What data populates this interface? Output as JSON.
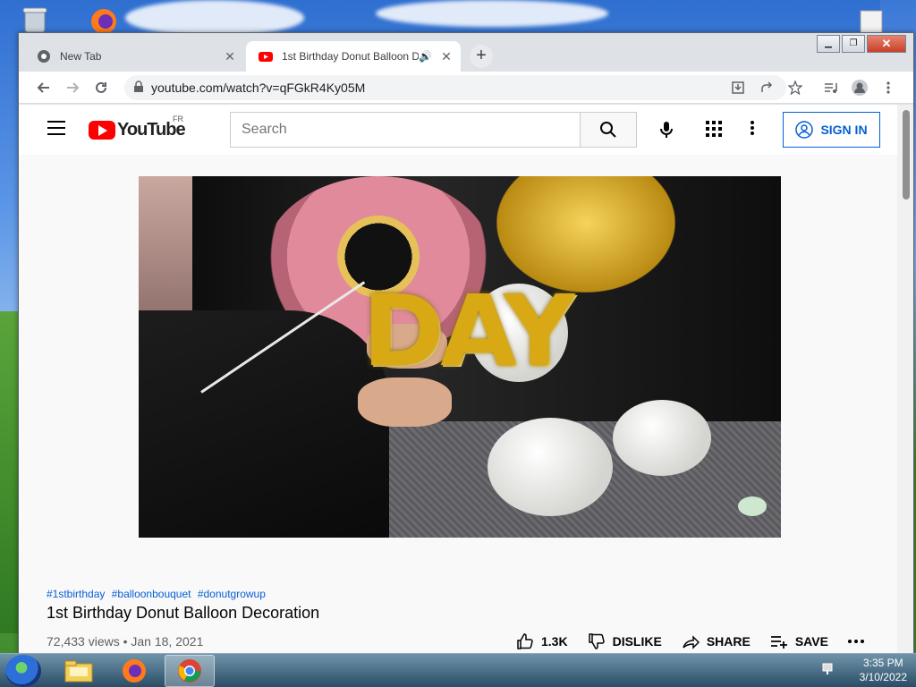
{
  "browser": {
    "tabs": [
      {
        "title": "New Tab"
      },
      {
        "title": "1st Birthday Donut Balloon D"
      }
    ],
    "address": "youtube.com/watch?v=qFGkR4Ky05M"
  },
  "youtube": {
    "region": "FR",
    "logo_text": "YouTube",
    "search_placeholder": "Search",
    "sign_in": "SIGN IN"
  },
  "video": {
    "hashtags": [
      "#1stbirthday",
      "#balloonbouquet",
      "#donutgrowup"
    ],
    "title": "1st Birthday Donut Balloon Decoration",
    "meta": "72,433 views • Jan 18, 2021",
    "overlay_text": "DAY",
    "actions": {
      "like_count": "1.3K",
      "dislike": "DISLIKE",
      "share": "SHARE",
      "save": "SAVE"
    }
  },
  "taskbar": {
    "time": "3:35 PM",
    "date": "3/10/2022"
  },
  "colors": {
    "youtube_red": "#ff0000",
    "link_blue": "#065fd4"
  }
}
